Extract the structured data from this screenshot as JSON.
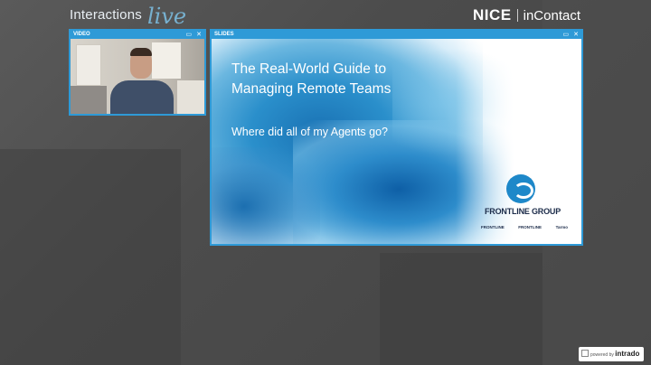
{
  "header": {
    "brand_left_main": "Interactions",
    "brand_left_script": "live",
    "brand_right_nice": "NICE",
    "brand_right_incontact": "inContact"
  },
  "video_panel": {
    "title": "VIDEO",
    "controls": [
      "▭",
      "✕"
    ]
  },
  "slides_panel": {
    "title": "SLIDES",
    "controls": [
      "▭",
      "✕"
    ],
    "slide": {
      "title_line1": "The Real-World Guide to",
      "title_line2": "Managing Remote Teams",
      "subtitle": "Where did all of my Agents go?",
      "logo_name": "FRONTLINE GROUP",
      "logo_subs": [
        "FRONTLINE",
        "FRONTLINE",
        "Tarmo"
      ]
    }
  },
  "footer": {
    "powered_by": "powered by",
    "brand": "intrado"
  },
  "colors": {
    "accent": "#2e9ad7",
    "background": "#4a4a4a"
  }
}
